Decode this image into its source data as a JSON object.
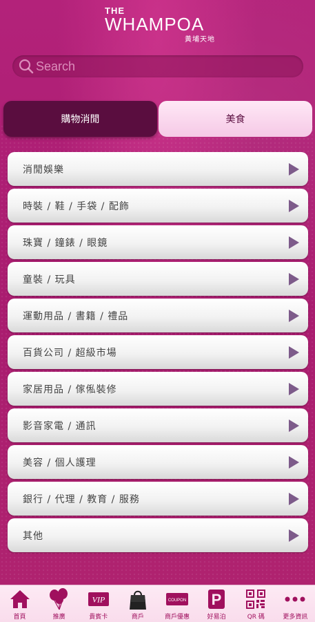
{
  "header": {
    "logo_the": "THE",
    "logo_main": "WHAMPOA",
    "logo_sub": "黃埔天地"
  },
  "search": {
    "placeholder": "Search",
    "icon": "search-icon"
  },
  "tabs": [
    {
      "label": "購物消閒",
      "active": true
    },
    {
      "label": "美食",
      "active": false
    }
  ],
  "categories": [
    "消閒娛樂",
    "時裝 / 鞋 / 手袋 / 配飾",
    "珠寶 / 鐘錶 / 眼鏡",
    "童裝 / 玩具",
    "運動用品 / 書籍 / 禮品",
    "百貨公司 / 超級市場",
    "家居用品 / 傢俬裝修",
    "影音家電 / 通訊",
    "美容 / 個人護理",
    "銀行 / 代理 / 教育 / 服務",
    "其他"
  ],
  "bottom_nav": [
    {
      "label": "首頁",
      "icon": "home-icon"
    },
    {
      "label": "推廣",
      "icon": "balloons-icon"
    },
    {
      "label": "貴賓卡",
      "icon": "vip-icon",
      "icon_text": "VIP"
    },
    {
      "label": "商戶",
      "icon": "shopping-bag-icon"
    },
    {
      "label": "商戶優惠",
      "icon": "coupon-icon",
      "icon_text": "COUPON"
    },
    {
      "label": "好易泊",
      "icon": "parking-icon",
      "icon_text": "P"
    },
    {
      "label": "QR 碼",
      "icon": "qr-code-icon"
    },
    {
      "label": "更多資訊",
      "icon": "more-icon"
    }
  ],
  "colors": {
    "background": "#b01f74",
    "active_tab": "#5a0d3f",
    "inactive_tab": "#f5c9e6",
    "arrow": "#7d5b8a",
    "nav_label": "#a0105e"
  }
}
